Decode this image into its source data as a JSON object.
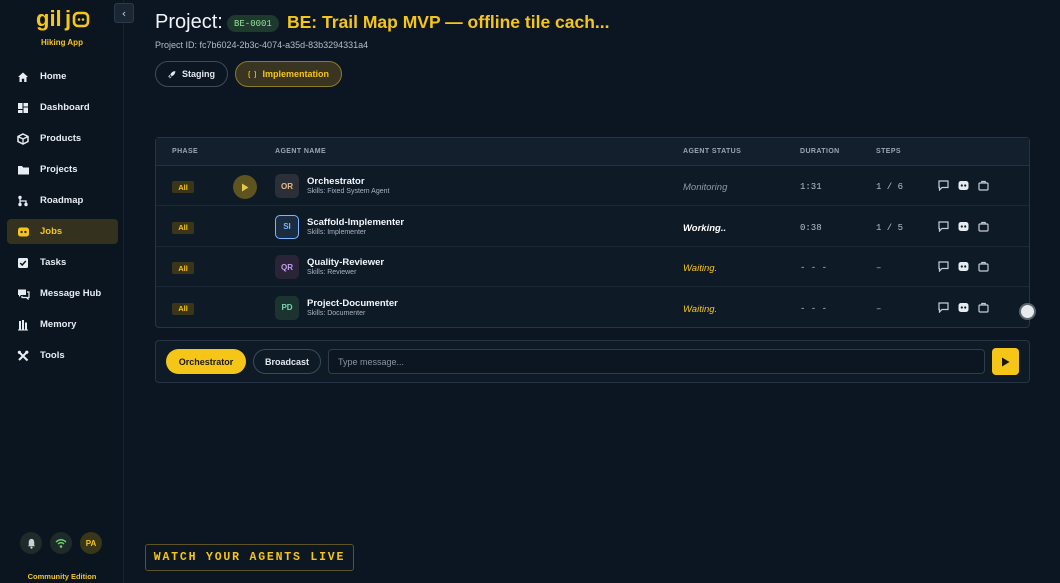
{
  "sidebar": {
    "app_name": "Hiking App",
    "nav": [
      {
        "label": "Home",
        "icon": "home-icon",
        "active": false
      },
      {
        "label": "Dashboard",
        "icon": "dashboard-icon",
        "active": false
      },
      {
        "label": "Products",
        "icon": "box-icon",
        "active": false
      },
      {
        "label": "Projects",
        "icon": "folder-icon",
        "active": false
      },
      {
        "label": "Roadmap",
        "icon": "roadmap-icon",
        "active": false
      },
      {
        "label": "Jobs",
        "icon": "jobs-icon",
        "active": true
      },
      {
        "label": "Tasks",
        "icon": "checkbox-icon",
        "active": false
      },
      {
        "label": "Message Hub",
        "icon": "chat-icon",
        "active": false
      },
      {
        "label": "Memory",
        "icon": "memory-icon",
        "active": false
      },
      {
        "label": "Tools",
        "icon": "tools-icon",
        "active": false
      }
    ],
    "user_initials": "PA",
    "edition": "Community Edition"
  },
  "header": {
    "label": "Project:",
    "code": "BE-0001",
    "title": "BE: Trail Map MVP — offline tile cach...",
    "project_id": "Project ID: fc7b6024-2b3c-4074-a35d-83b3294331a4"
  },
  "tabs": [
    {
      "label": "Staging",
      "active": false
    },
    {
      "label": "Implementation",
      "active": true
    }
  ],
  "table": {
    "columns": [
      "PHASE",
      "AGENT NAME",
      "AGENT STATUS",
      "DURATION",
      "STEPS"
    ],
    "rows": [
      {
        "phase": "All",
        "initials": "OR",
        "name": "Orchestrator",
        "skills": "Skills: Fixed System Agent",
        "status": "Monitoring",
        "duration": "1:31",
        "steps": "1 / 6",
        "avatar_bg": "#2b3038",
        "avatar_fg": "#e8b98c",
        "avatar_border": "#2b3038",
        "status_color": "#8e9aa8",
        "status_weight": "normal"
      },
      {
        "phase": "All",
        "initials": "SI",
        "name": "Scaffold-Implementer",
        "skills": "Skills: Implementer",
        "status": "Working..",
        "duration": "0:38",
        "steps": "1 / 5",
        "avatar_bg": "#1a2c40",
        "avatar_fg": "#7fb3ff",
        "avatar_border": "#7fb3ff",
        "status_color": "#ffffff",
        "status_weight": "bold"
      },
      {
        "phase": "All",
        "initials": "QR",
        "name": "Quality-Reviewer",
        "skills": "Skills: Reviewer",
        "status": "Waiting.",
        "duration": "- - -",
        "steps": "–",
        "avatar_bg": "#2a2438",
        "avatar_fg": "#c49ef0",
        "avatar_border": "#2a2438",
        "status_color": "#f5c518",
        "status_weight": "normal"
      },
      {
        "phase": "All",
        "initials": "PD",
        "name": "Project-Documenter",
        "skills": "Skills: Documenter",
        "status": "Waiting.",
        "duration": "- - -",
        "steps": "–",
        "avatar_bg": "#1c3430",
        "avatar_fg": "#79d6b0",
        "avatar_border": "#1c3430",
        "status_color": "#f5c518",
        "status_weight": "normal"
      }
    ]
  },
  "message_bar": {
    "target_active": "Orchestrator",
    "target_other": "Broadcast",
    "placeholder": "Type message..."
  },
  "banner": "WATCH YOUR AGENTS LIVE",
  "colors": {
    "accent": "#f5c518",
    "background": "#0c1623"
  }
}
